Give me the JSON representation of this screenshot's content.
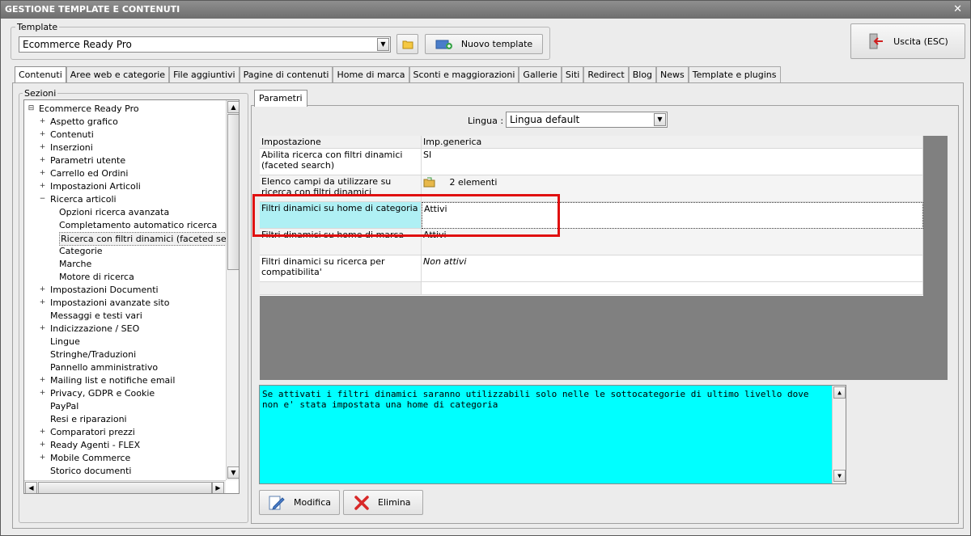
{
  "window": {
    "title": "GESTIONE TEMPLATE E CONTENUTI",
    "close_glyph": "✕"
  },
  "template": {
    "label": "Template",
    "selected": "Ecommerce Ready Pro",
    "new_button": "Nuovo template",
    "exit_button": "Uscita (ESC)"
  },
  "tabs": [
    "Contenuti",
    "Aree web e categorie",
    "File aggiuntivi",
    "Pagine di contenuti",
    "Home di marca",
    "Sconti e maggiorazioni",
    "Gallerie",
    "Siti",
    "Redirect",
    "Blog",
    "News",
    "Template e plugins"
  ],
  "sections": {
    "label": "Sezioni",
    "root": "Ecommerce Ready Pro",
    "items": [
      {
        "label": "Aspetto grafico",
        "level": 1,
        "exp": "+"
      },
      {
        "label": "Contenuti",
        "level": 1,
        "exp": "+"
      },
      {
        "label": "Inserzioni",
        "level": 1,
        "exp": "+"
      },
      {
        "label": "Parametri utente",
        "level": 1,
        "exp": "+"
      },
      {
        "label": "Carrello ed Ordini",
        "level": 1,
        "exp": "+"
      },
      {
        "label": "Impostazioni Articoli",
        "level": 1,
        "exp": "+"
      },
      {
        "label": "Ricerca articoli",
        "level": 1,
        "exp": "-"
      },
      {
        "label": "Opzioni ricerca avanzata",
        "level": 2,
        "exp": ""
      },
      {
        "label": "Completamento automatico ricerca",
        "level": 2,
        "exp": ""
      },
      {
        "label": "Ricerca con filtri dinamici (faceted search)",
        "level": 2,
        "exp": "",
        "selected": true
      },
      {
        "label": "Categorie",
        "level": 2,
        "exp": ""
      },
      {
        "label": "Marche",
        "level": 2,
        "exp": ""
      },
      {
        "label": "Motore di ricerca",
        "level": 2,
        "exp": ""
      },
      {
        "label": "Impostazioni Documenti",
        "level": 1,
        "exp": "+"
      },
      {
        "label": "Impostazioni avanzate sito",
        "level": 1,
        "exp": "+"
      },
      {
        "label": "Messaggi e testi vari",
        "level": 1,
        "exp": ""
      },
      {
        "label": "Indicizzazione / SEO",
        "level": 1,
        "exp": "+"
      },
      {
        "label": "Lingue",
        "level": 1,
        "exp": ""
      },
      {
        "label": "Stringhe/Traduzioni",
        "level": 1,
        "exp": ""
      },
      {
        "label": "Pannello amministrativo",
        "level": 1,
        "exp": ""
      },
      {
        "label": "Mailing list e notifiche email",
        "level": 1,
        "exp": "+"
      },
      {
        "label": "Privacy, GDPR e Cookie",
        "level": 1,
        "exp": "+"
      },
      {
        "label": "PayPal",
        "level": 1,
        "exp": ""
      },
      {
        "label": "Resi e riparazioni",
        "level": 1,
        "exp": ""
      },
      {
        "label": "Comparatori prezzi",
        "level": 1,
        "exp": "+"
      },
      {
        "label": "Ready Agenti - FLEX",
        "level": 1,
        "exp": "+"
      },
      {
        "label": "Mobile Commerce",
        "level": 1,
        "exp": "+"
      },
      {
        "label": "Storico documenti",
        "level": 1,
        "exp": ""
      }
    ]
  },
  "params": {
    "tab_label": "Parametri",
    "lingua_label": "Lingua :",
    "lingua_value": "Lingua default",
    "col_setting": "Impostazione",
    "col_value": "Imp.generica",
    "rows": [
      {
        "setting": "Abilita ricerca con filtri dinamici (faceted search)",
        "value": "SI"
      },
      {
        "setting": "Elenco campi da utilizzare su ricerca con filtri dinamici",
        "value": "2 elementi"
      },
      {
        "setting": "Filtri dinamici su home di categoria",
        "value": "Attivi"
      },
      {
        "setting": "Filtri dinamici su home di marca",
        "value": "Attivi"
      },
      {
        "setting": "Filtri dinamici su ricerca per compatibilita'",
        "value": "Non attivi"
      }
    ],
    "description": "Se attivati i filtri dinamici saranno utilizzabili solo nelle le sottocategorie di ultimo livello dove non e' stata impostata una home di categoria",
    "edit_button": "Modifica",
    "delete_button": "Elimina"
  },
  "colors": {
    "highlight_box": "#e01010",
    "selected_row": "#aff0f4",
    "description_bg": "#00ffff"
  }
}
